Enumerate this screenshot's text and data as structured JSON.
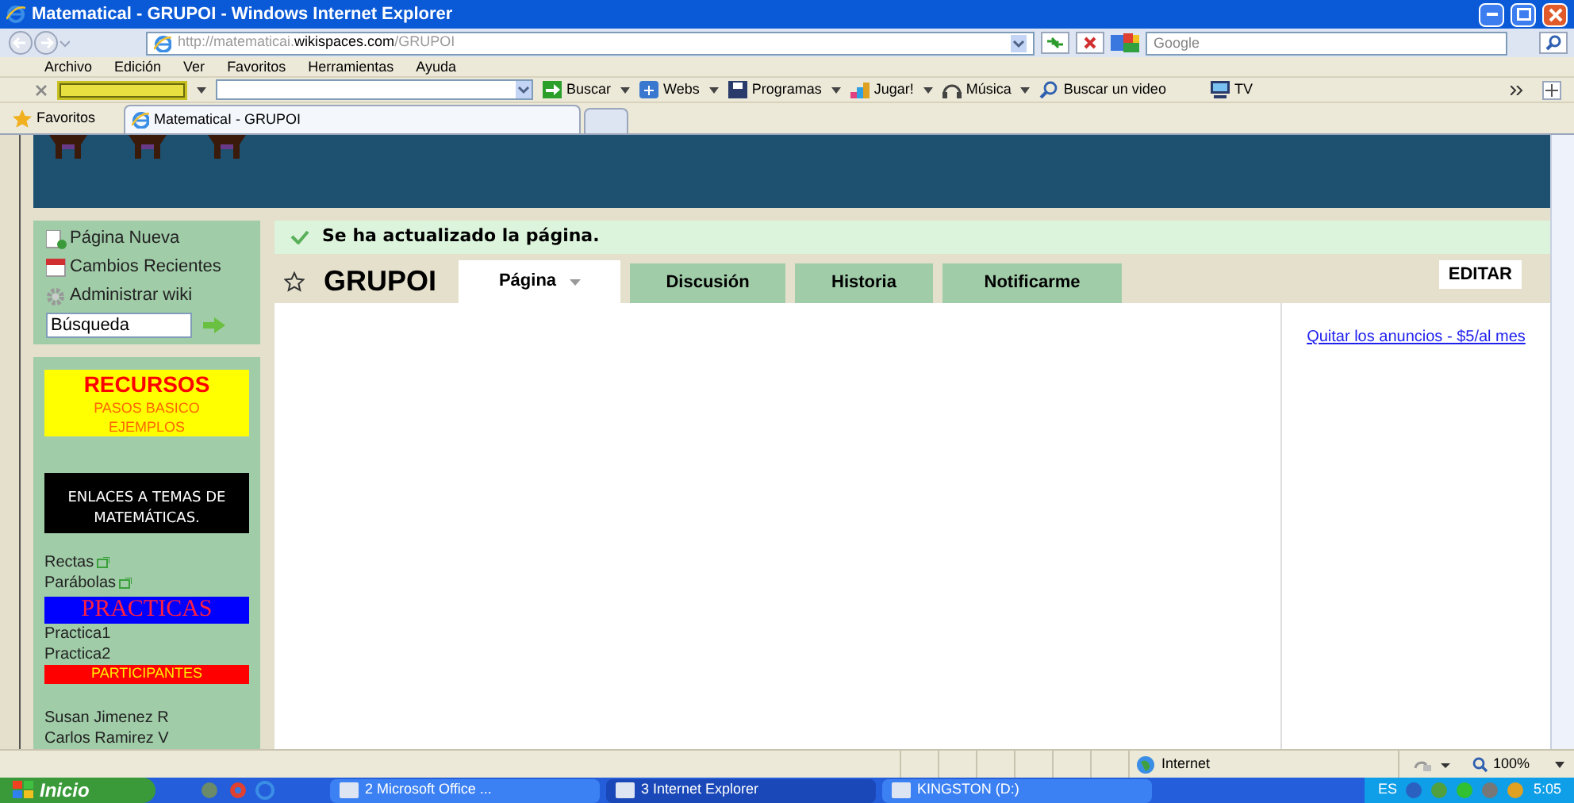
{
  "window": {
    "title": "Matematical - GRUPOI - Windows Internet Explorer"
  },
  "address_bar": {
    "url_prefix": "http://matematicai.",
    "url_domain": "wikispaces.com",
    "url_path": "/GRUPOI",
    "search_placeholder": "Google"
  },
  "menu": [
    "Archivo",
    "Edición",
    "Ver",
    "Favoritos",
    "Herramientas",
    "Ayuda"
  ],
  "toolbar": {
    "items": [
      {
        "label": "Buscar",
        "kind": "go"
      },
      {
        "label": "Webs",
        "kind": "webs"
      },
      {
        "label": "Programas",
        "kind": "disk"
      },
      {
        "label": "Jugar!",
        "kind": "game"
      },
      {
        "label": "Música",
        "kind": "music"
      },
      {
        "label": "Buscar un video",
        "kind": "search"
      },
      {
        "label": "TV",
        "kind": "tv"
      }
    ]
  },
  "favorites": {
    "label": "Favoritos"
  },
  "tabs": [
    {
      "label": "MatematicaI - GRUPOI",
      "selected": true
    }
  ],
  "sidebar": {
    "actions": [
      {
        "label": "Página Nueva",
        "kind": "new"
      },
      {
        "label": "Cambios Recientes",
        "kind": "calendar"
      },
      {
        "label": "Administrar wiki",
        "kind": "gear"
      }
    ],
    "search_value": "Búsqueda",
    "widgets": [
      {
        "kind": "resources",
        "lines": [
          "RECURSOS",
          "PASOS BASICO",
          "EJEMPLOS"
        ]
      },
      {
        "kind": "dark",
        "lines": [
          "ENLACES A TEMAS DE MATEMÁTICAS."
        ]
      },
      {
        "kind": "link",
        "label": "Rectas",
        "external": true
      },
      {
        "kind": "link",
        "label": "Parábolas",
        "external": true
      },
      {
        "kind": "blue",
        "lines": [
          "PRACTICAS"
        ]
      },
      {
        "kind": "link",
        "label": "Practica1",
        "external": false
      },
      {
        "kind": "link",
        "label": "Practica2",
        "external": false
      },
      {
        "kind": "red",
        "lines": [
          "PARTICIPANTES"
        ]
      },
      {
        "kind": "gap"
      },
      {
        "kind": "link",
        "label": "Susan Jimenez R",
        "external": false
      },
      {
        "kind": "link",
        "label": "Carlos Ramirez V",
        "external": false
      }
    ]
  },
  "notice": "Se ha actualizado la página.",
  "page_title": "GRUPOI",
  "page_tabs": [
    {
      "label": "Página",
      "selected": true
    },
    {
      "label": "Discusión",
      "selected": false
    },
    {
      "label": "Historia",
      "selected": false
    },
    {
      "label": "Notificarme",
      "selected": false
    }
  ],
  "edit_button": "EDITAR",
  "ad_link": "Quitar los anuncios - $5/al mes",
  "status_bar": {
    "zone": "Internet",
    "zoom": "100%"
  },
  "taskbar": {
    "start": "Inicio",
    "tasks": [
      {
        "label": "2 Microsoft Office ...",
        "selected": false
      },
      {
        "label": "3 Internet Explorer",
        "selected": true
      },
      {
        "label": "KINGSTON (D:)",
        "selected": false
      }
    ],
    "language": "ES",
    "clock": "5:05"
  }
}
